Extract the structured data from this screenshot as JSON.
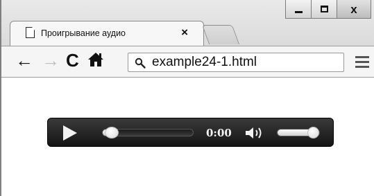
{
  "window": {
    "minimize_icon": "minimize-icon",
    "maximize_icon": "maximize-icon",
    "close_label": "x"
  },
  "tab": {
    "title": "Проигрывание аудио",
    "close_label": "×",
    "icon": "document-icon"
  },
  "toolbar": {
    "back_label": "←",
    "forward_label": "→",
    "reload_label": "C",
    "home_icon": "home-icon",
    "menu_icon": "hamburger-menu-icon"
  },
  "address_bar": {
    "value": "example24-1.html",
    "icon": "search-icon"
  },
  "audio_player": {
    "state": "paused",
    "time": "0:00",
    "progress_fraction": 0.1,
    "volume_fraction": 0.85,
    "colors": {
      "background": "#1e1e1e",
      "controls": "#f2f2f2"
    }
  }
}
